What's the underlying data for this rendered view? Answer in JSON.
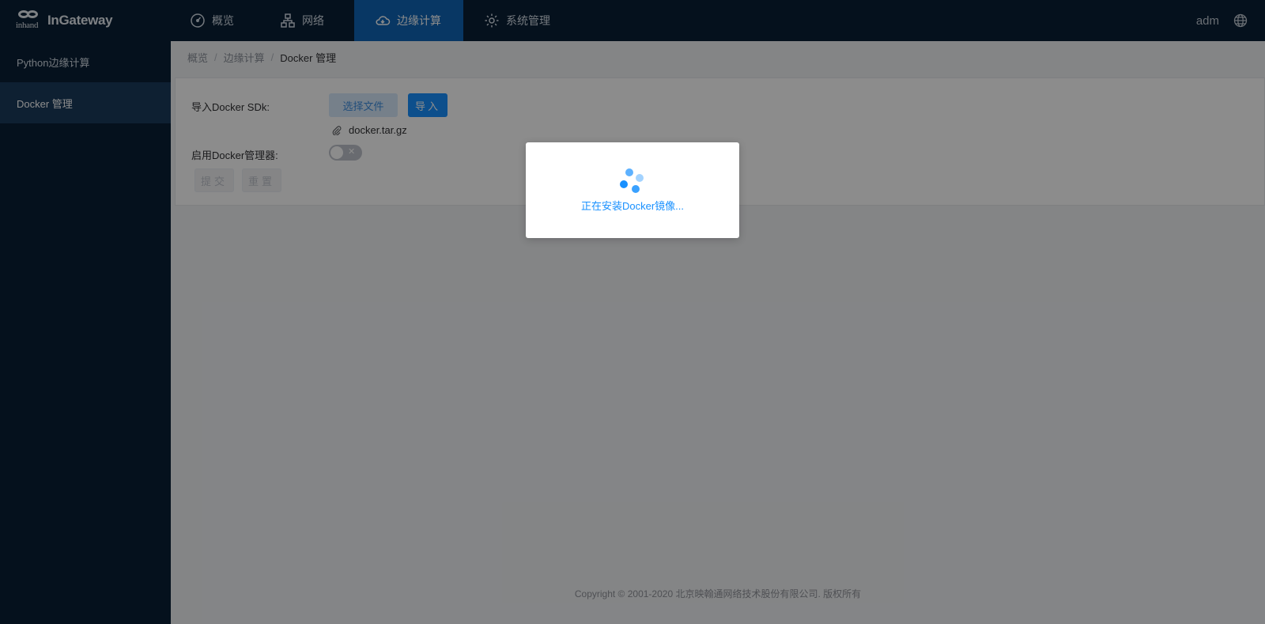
{
  "header": {
    "brand_mark": "inhand",
    "brand": "InGateway",
    "nav": [
      {
        "label": "概览",
        "icon": "dashboard-icon"
      },
      {
        "label": "网络",
        "icon": "network-icon"
      },
      {
        "label": "边缘计算",
        "icon": "cloud-icon",
        "active": true
      },
      {
        "label": "系统管理",
        "icon": "gear-icon"
      }
    ],
    "user": "adm",
    "language_icon": "globe-icon"
  },
  "sidebar": {
    "items": [
      {
        "label": "Python边缘计算",
        "active": false
      },
      {
        "label": "Docker 管理",
        "active": true
      }
    ]
  },
  "breadcrumb": [
    "概览",
    "边缘计算",
    "Docker 管理"
  ],
  "form": {
    "sdk_label": "导入Docker SDk:",
    "choose_file_label": "选择文件",
    "import_label": "导入",
    "file_name": "docker.tar.gz",
    "file_icon": "paperclip-icon",
    "enable_label": "启用Docker管理器:",
    "enable_toggle": false,
    "submit_label": "提交",
    "reset_label": "重置"
  },
  "footer": {
    "copyright": "Copyright © 2001-2020 北京映翰通网络技术股份有限公司. 版权所有"
  },
  "loading_modal": {
    "text": "正在安装Docker镜像..."
  },
  "colors": {
    "topbar_bg": "#0a1f35",
    "nav_active_bg": "#1064b6",
    "sidebar_active_bg": "#1a3b5c",
    "primary": "#1890ff"
  }
}
